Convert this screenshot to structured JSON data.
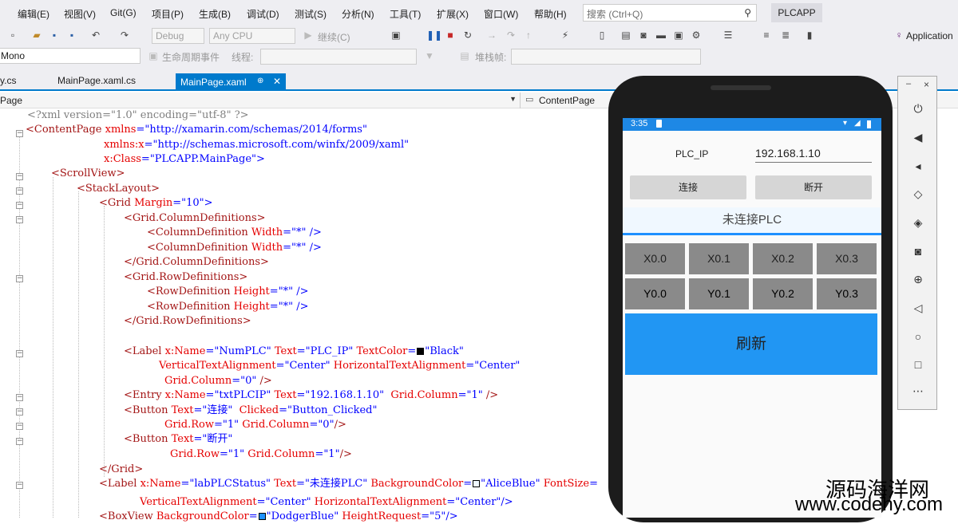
{
  "menubar": {
    "items": [
      "编辑(E)",
      "视图(V)",
      "Git(G)",
      "项目(P)",
      "生成(B)",
      "调试(D)",
      "测试(S)",
      "分析(N)",
      "工具(T)",
      "扩展(X)",
      "窗口(W)",
      "帮助(H)"
    ],
    "search_placeholder": "搜索 (Ctrl+Q)",
    "solution_name": "PLCAPP"
  },
  "toolbar": {
    "config": "Debug",
    "platform": "Any CPU",
    "continue_label": "继续(C)",
    "application_label": "Application",
    "mono_target": "Mono",
    "lifecycle_label": "生命周期事件",
    "thread_label": "线程:",
    "stack_label": "堆栈帧:"
  },
  "tabs": {
    "tab1": "y.cs",
    "tab2": "MainPage.xaml.cs",
    "active": "MainPage.xaml",
    "pin_icon": "⊕",
    "close_icon": "✕"
  },
  "navbar": {
    "left": "Page",
    "right": "ContentPage"
  },
  "code": {
    "l1": "<?xml version=\"1.0\" encoding=\"utf-8\" ?>",
    "l2a": "<ContentPage",
    "l2b": " xmlns",
    "l2c": "=\"http://xamarin.com/schemas/2014/forms\"",
    "l3a": "xmlns:x",
    "l3b": "=\"http://schemas.microsoft.com/winfx/2009/xaml\"",
    "l4a": "x:Class",
    "l4b": "=\"PLCAPP.MainPage\">",
    "l5": "<ScrollView>",
    "l6": "<StackLayout>",
    "l7a": "<Grid",
    "l7b": " Margin",
    "l7c": "=\"10\">",
    "l8": "<Grid.ColumnDefinitions>",
    "l9a": "<ColumnDefinition",
    "l9b": " Width",
    "l9c": "=\"*\" />",
    "l10a": "<ColumnDefinition",
    "l10b": " Width",
    "l10c": "=\"*\" />",
    "l11": "</Grid.ColumnDefinitions>",
    "l12": "<Grid.RowDefinitions>",
    "l13a": "<RowDefinition",
    "l13b": " Height",
    "l13c": "=\"*\" />",
    "l14a": "<RowDefinition",
    "l14b": " Height",
    "l14c": "=\"*\" />",
    "l15": "</Grid.RowDefinitions>",
    "l16a": "<Label",
    "l16b": " x:Name",
    "l16c": "=\"NumPLC\"",
    "l16d": " Text",
    "l16e": "=\"PLC_IP\"",
    "l16f": " TextColor",
    "l16g": "=",
    "l16h": "\"Black\"",
    "l17a": "VerticalTextAlignment",
    "l17b": "=\"Center\"",
    "l17c": " HorizontalTextAlignment",
    "l17d": "=\"Center\"",
    "l18a": "Grid.Column",
    "l18b": "=\"0\"",
    "l18c": " />",
    "l19a": "<Entry",
    "l19b": " x:Name",
    "l19c": "=\"txtPLCIP\"",
    "l19d": " Text",
    "l19e": "=\"192.168.1.10\"",
    "l19f": "  Grid.Column",
    "l19g": "=\"1\"",
    "l19h": " />",
    "l20a": "<Button",
    "l20b": " Text",
    "l20c": "=\"连接\"",
    "l20d": "  Clicked",
    "l20e": "=\"Button_Clicked\"",
    "l21a": "Grid.Row",
    "l21b": "=\"1\"",
    "l21c": " Grid.Column",
    "l21d": "=\"0\"",
    "l21e": "/>",
    "l22a": "<Button",
    "l22b": " Text",
    "l22c": "=\"断开\"",
    "l23a": "Grid.Row",
    "l23b": "=\"1\"",
    "l23c": " Grid.Column",
    "l23d": "=\"1\"",
    "l23e": "/>",
    "l24": "</Grid>",
    "l25a": "<Label",
    "l25b": " x:Name",
    "l25c": "=\"labPLCStatus\"",
    "l25d": " Text",
    "l25e": "=\"未连接PLC\"",
    "l25f": " BackgroundColor",
    "l25g": "=",
    "l25h": "\"AliceBlue\"",
    "l25i": " FontSize",
    "l25j": "=",
    "l26a": "VerticalTextAlignment",
    "l26b": "=\"Center\"",
    "l26c": " HorizontalTextAlignment",
    "l26d": "=\"Center\"/>",
    "l27a": "<BoxView",
    "l27b": " BackgroundColor",
    "l27c": "=",
    "l27d": "\"DodgerBlue\"",
    "l27e": " HeightRequest",
    "l27f": "=\"5\"/>"
  },
  "phone": {
    "time": "3:35",
    "ip_label": "PLC_IP",
    "ip_value": "192.168.1.10",
    "connect_button": "连接",
    "disconnect_button": "断开",
    "status_text": "未连接PLC",
    "x_labels": [
      "X0.0",
      "X0.1",
      "X0.2",
      "X0.3"
    ],
    "y_labels": [
      "Y0.0",
      "Y0.1",
      "Y0.2",
      "Y0.3"
    ],
    "refresh_button": "刷新"
  },
  "emulator_panel": {
    "minimize": "–",
    "close": "×",
    "icons": [
      "power-icon",
      "volume-up-icon",
      "volume-down-icon",
      "rotate-left-icon",
      "rotate-right-icon",
      "camera-icon",
      "zoom-icon",
      "back-icon",
      "home-icon",
      "overview-icon",
      "more-icon"
    ]
  },
  "watermark": {
    "line1": "源码海洋网",
    "line2": "www.codehy.com"
  },
  "colors": {
    "accent": "#007acc",
    "phone_blue": "#2196f3",
    "io_gray": "#8a8a8a"
  }
}
